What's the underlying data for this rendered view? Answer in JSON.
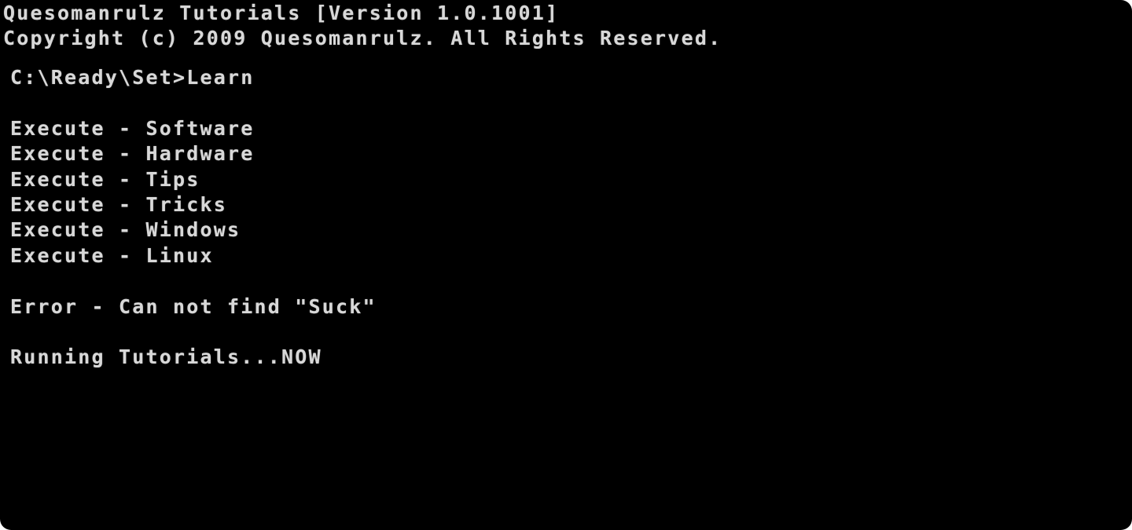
{
  "console": {
    "header": {
      "title": "Quesomanrulz Tutorials [Version 1.0.1001]",
      "copyright": "Copyright (c) 2009 Quesomanrulz. All Rights Reserved."
    },
    "prompt": "C:\\Ready\\Set>Learn",
    "execute_lines": [
      "Execute - Software",
      "Execute - Hardware",
      "Execute - Tips",
      "Execute - Tricks",
      "Execute - Windows",
      "Execute - Linux"
    ],
    "error_line": "Error - Can not find \"Suck\"",
    "status_line": "Running Tutorials...NOW"
  },
  "colors": {
    "background": "#000000",
    "text": "#d8d8d8"
  }
}
